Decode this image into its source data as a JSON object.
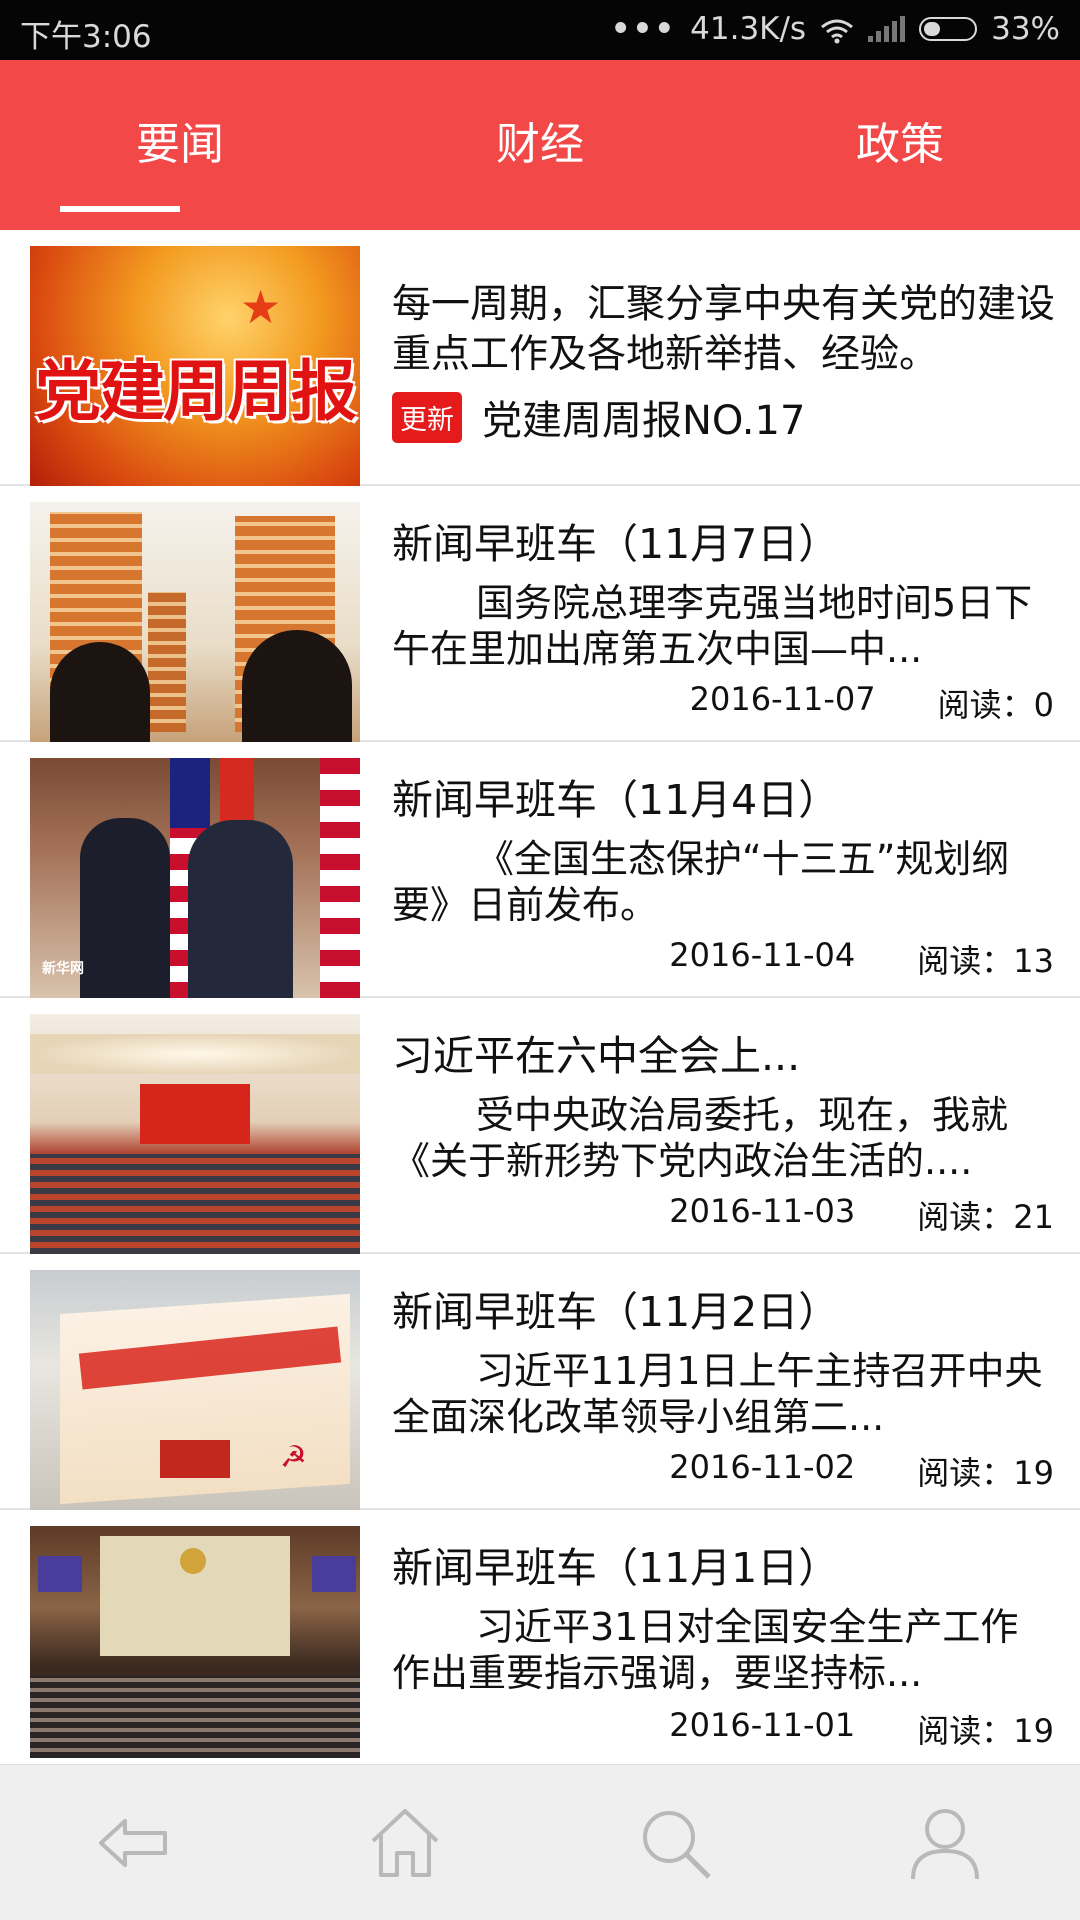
{
  "status_bar": {
    "time": "下午3:06",
    "dots": "•••",
    "speed": "41.3K/s",
    "battery": "33%",
    "battery_level": 0.33
  },
  "tabs": [
    {
      "label": "要闻",
      "active": true
    },
    {
      "label": "财经",
      "active": false
    },
    {
      "label": "政策",
      "active": false
    }
  ],
  "featured": {
    "description": "每一周期，汇聚分享中央有关党的建设重点工作及各地新举措、经验。",
    "badge": "更新",
    "subtitle": "党建周周报NO.17",
    "image_text": "党建周周报"
  },
  "news": [
    {
      "title": "新闻早班车（11月7日）",
      "summary": "国务院总理李克强当地时间5日下午在里加出席第五次中国—中...",
      "date": "2016-11-07",
      "reads": "阅读：0"
    },
    {
      "title": "新闻早班车（11月4日）",
      "summary": "《全国生态保护“十三五”规划纲要》日前发布。",
      "date": "2016-11-04",
      "reads": "阅读：13"
    },
    {
      "title": "习近平在六中全会上...",
      "summary": "受中央政治局委托，现在，我就《关于新形势下党内政治生活的....",
      "date": "2016-11-03",
      "reads": "阅读：21"
    },
    {
      "title": "新闻早班车（11月2日）",
      "summary": "习近平11月1日上午主持召开中央全面深化改革领导小组第二...",
      "date": "2016-11-02",
      "reads": "阅读：19"
    },
    {
      "title": "新闻早班车（11月1日）",
      "summary": "习近平31日对全国安全生产工作作出重要指示强调，要坚持标...",
      "date": "2016-11-01",
      "reads": "阅读：19"
    }
  ],
  "bottom_nav": [
    {
      "icon": "back-icon"
    },
    {
      "icon": "home-icon"
    },
    {
      "icon": "search-icon"
    },
    {
      "icon": "user-icon"
    }
  ],
  "colors": {
    "header": "#f24848",
    "badge": "#e51b1b"
  }
}
